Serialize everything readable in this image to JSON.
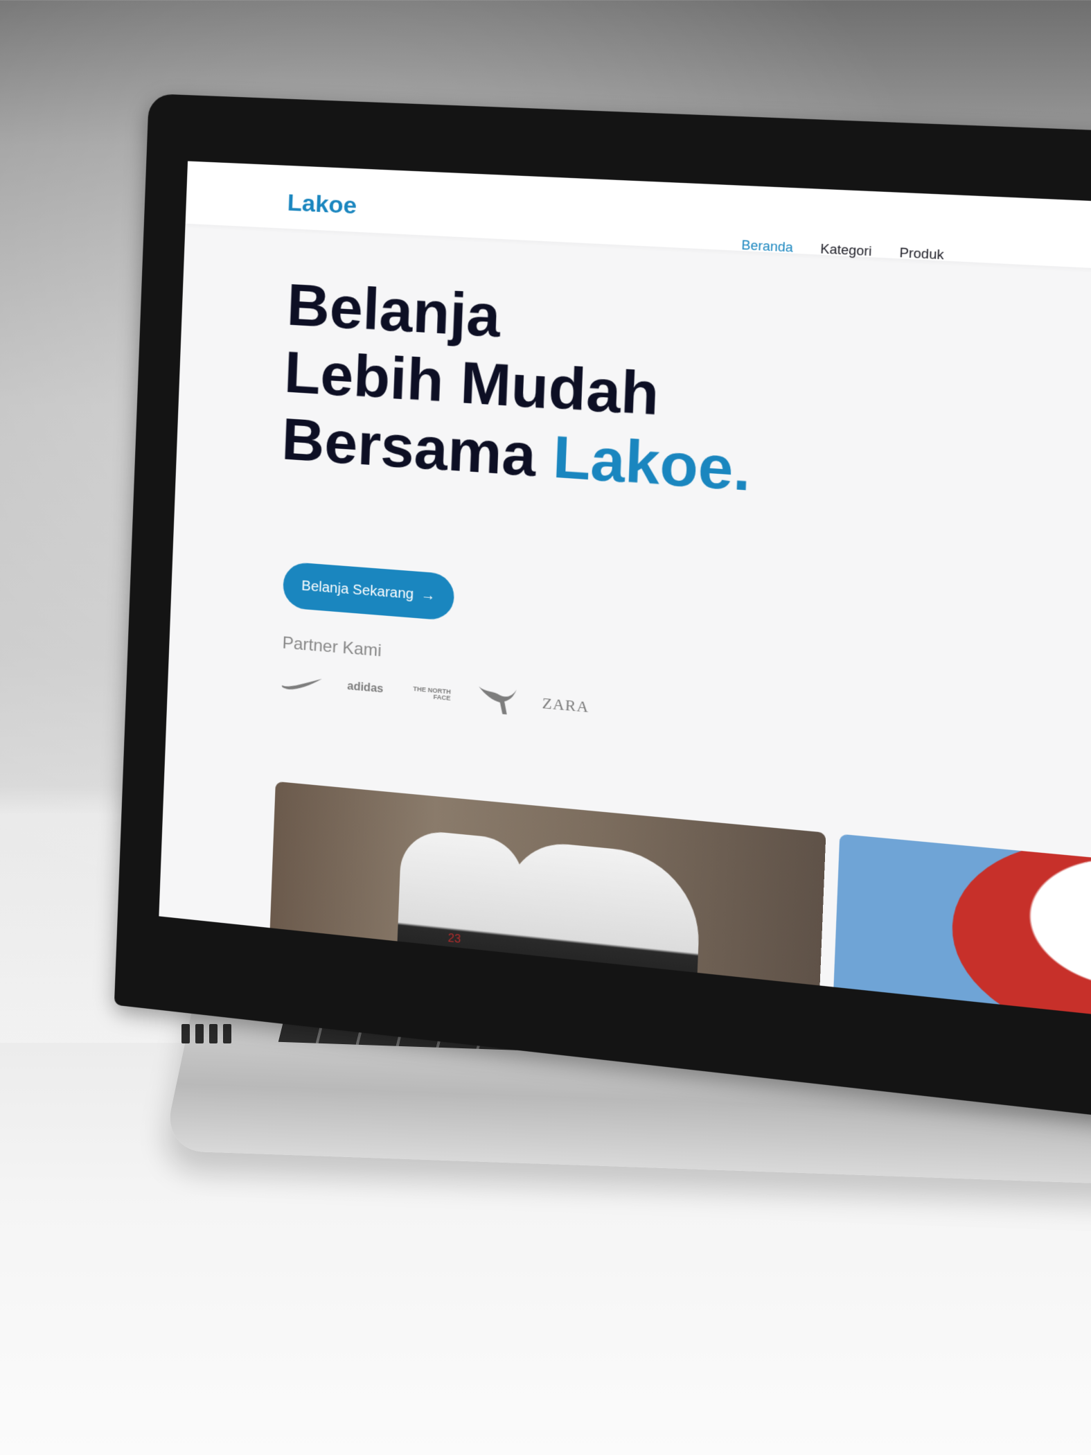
{
  "site": {
    "brand": "Lakoe",
    "nav": [
      {
        "label": "Beranda",
        "active": true
      },
      {
        "label": "Kategori",
        "active": false
      },
      {
        "label": "Produk",
        "active": false
      }
    ]
  },
  "hero": {
    "line1": "Belanja",
    "line2": "Lebih Mudah",
    "line3_prefix": "Bersama",
    "line3_accent": "Lakoe.",
    "cta_label": "Belanja Sekarang",
    "cta_icon": "→",
    "carousel_prev_icon": "←"
  },
  "partners": {
    "label": "Partner Kami",
    "logos": [
      {
        "name": "nike-logo"
      },
      {
        "name": "adidas-logo",
        "text": "adidas"
      },
      {
        "name": "the-north-face-logo",
        "text": "THE NORTH FACE"
      },
      {
        "name": "puma-logo"
      },
      {
        "name": "zara-logo",
        "text": "ZARA"
      }
    ]
  },
  "cards": {
    "shoes_number": "23"
  },
  "colors": {
    "accent": "#1a86bf",
    "heading": "#0d0f24",
    "muted": "#888888"
  }
}
